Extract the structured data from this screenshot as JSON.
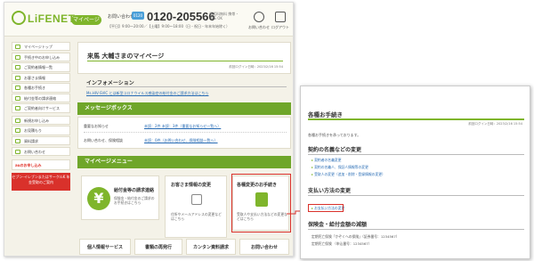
{
  "header": {
    "logo_text": "LiFENET",
    "mypage_badge": "マイページ",
    "contact_label": "お問い合わせ",
    "free_dial": "0120",
    "phone": "0120-205566",
    "phone_note": "通話料無料 携帯・PHS OK",
    "hours": "【平日】9:00〜20:00／【土曜】9:00〜18:00（日・祝日・年末年始除く）",
    "help_label": "お問い合わせ",
    "logout_label": "ログアウト"
  },
  "sidebar": {
    "items": [
      {
        "label": "マイページトップ"
      },
      {
        "label": "手続き中のお申し込み"
      },
      {
        "label": "ご契約者情報一覧"
      },
      {
        "label": "お客さま情報"
      },
      {
        "label": "各種お手続き"
      },
      {
        "label": "給付金等の請求連絡"
      },
      {
        "label": "ご契約者向けサービス"
      },
      {
        "label": "新規お申し込み"
      },
      {
        "label": "お見積もり"
      },
      {
        "label": "資料請求"
      },
      {
        "label": "お問い合わせ"
      }
    ],
    "banner": "auのお申し込み",
    "red_banner": "セブン-イレブンまたはサークルK 年金受取のご案内"
  },
  "main": {
    "greeting": "来馬 大輔さまのマイページ",
    "last_login": "前回ログイン日時：2023/2/16 15:54",
    "info_title": "インフォメーション",
    "info_text": "Ms.HIV-SVIC とは新型コロナウイルス感染症の給付金のご請求方法はこちら",
    "message_box_title": "メッセージボックス",
    "messages": [
      {
        "label": "重要なお知らせ",
        "link": "未読：2件 未読：3件（重要なお知らせ一覧へ）"
      },
      {
        "label": "お問い合わせ、保険相談",
        "link": "未読：0件（お問い合わせ、保険相談一覧へ）"
      }
    ],
    "menu_title": "マイページメニュー",
    "card_claim_title": "給付金等の請求連絡",
    "card_claim_desc": "保険金・給付金のご請求のお手続きはこちら",
    "card_info_title": "お客さま情報の変更",
    "card_info_desc": "住所やメールアドレスの変更などはこちら",
    "card_change_title": "各種変更のお手続き",
    "card_change_desc": "受取人や支払い方法などの変更などはこちら",
    "bottom_cards": [
      "個人情報サービス",
      "書類の再発行",
      "カンタン資料請求",
      "お問い合わせ"
    ]
  },
  "detail": {
    "title": "各種お手続き",
    "date": "前回ログイン日時：2023/2/16 15:54",
    "intro": "各種お手続きを承っております。",
    "sec1": "契約の名義などの変更",
    "sec1_links": [
      "契約者の名義変更",
      "契約の名義人、保証人情報等の変更",
      "受取人の変更（追加・削除・登録情報の変更）"
    ],
    "sec2": "支払い方法の変更",
    "sec2_link": "お支払い方法の変更",
    "sec3": "保険金・給付金額の減額",
    "sec3_texts": [
      "定期死亡保険「かぞくへの保険」（証券番号：1234567）",
      "定期死亡保険 （申込番号：1234567）"
    ]
  },
  "colors": {
    "accent": "#7fb52c",
    "highlight": "#d9312b",
    "link": "#2a6db5"
  }
}
